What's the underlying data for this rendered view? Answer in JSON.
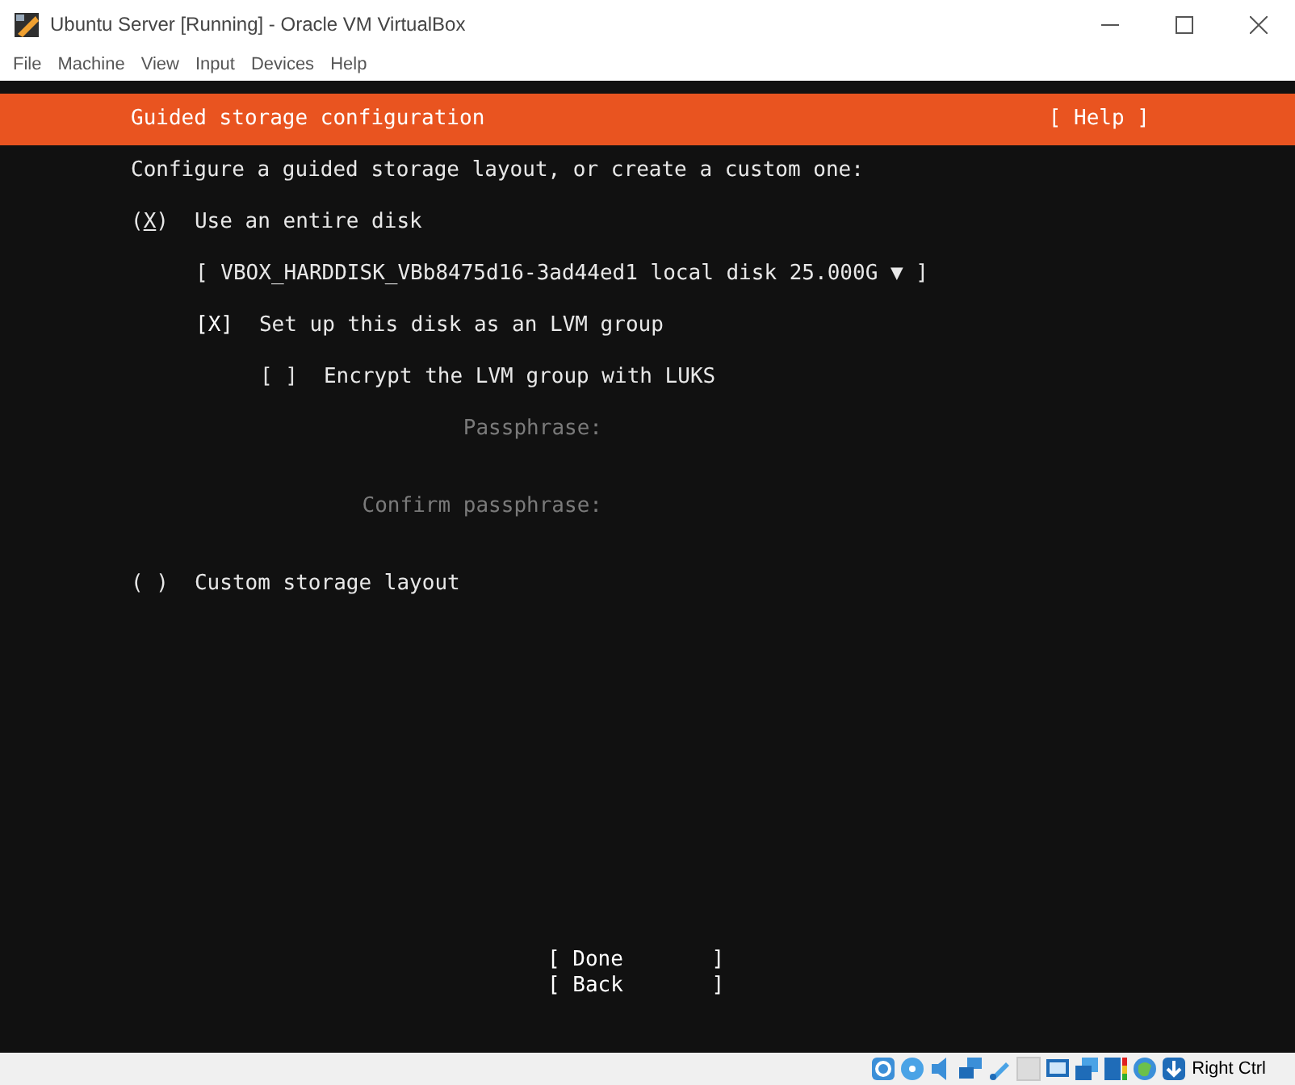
{
  "window": {
    "title": "Ubuntu Server [Running] - Oracle VM VirtualBox"
  },
  "menu": [
    "File",
    "Machine",
    "View",
    "Input",
    "Devices",
    "Help"
  ],
  "header": {
    "title": "Guided storage configuration",
    "help": "[ Help ]"
  },
  "intro": "Configure a guided storage layout, or create a custom one:",
  "entire_disk": {
    "mark": "(X)",
    "label": "Use an entire disk",
    "focused": true
  },
  "disk_select": "[ VBOX_HARDDISK_VBb8475d16-3ad44ed1 local disk 25.000G ▼ ]",
  "lvm": {
    "mark": "[X]",
    "label": "Set up this disk as an LVM group",
    "checked": true
  },
  "encrypt": {
    "mark": "[ ]",
    "label": "Encrypt the LVM group with LUKS",
    "checked": false
  },
  "fields": [
    {
      "label": "Passphrase:",
      "disabled": true
    },
    {
      "label": "Confirm passphrase:",
      "disabled": true
    }
  ],
  "custom": {
    "mark": "( )",
    "label": "Custom storage layout",
    "focused": false
  },
  "buttons": [
    "[ Done       ]",
    "[ Back       ]"
  ],
  "status_bar": {
    "host_key": "Right Ctrl"
  }
}
